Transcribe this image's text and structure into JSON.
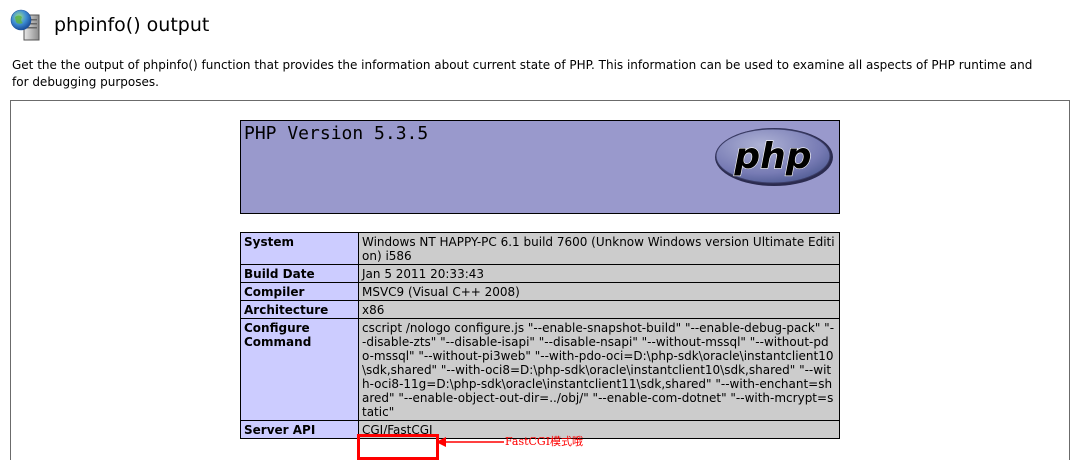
{
  "header": {
    "title": "phpinfo() output",
    "description": "Get the the output of phpinfo() function that provides the information about current state of PHP. This information can be used to examine all aspects of PHP runtime and for debugging purposes."
  },
  "php": {
    "version_title": "PHP Version 5.3.5",
    "logo_text": "php"
  },
  "info_rows": [
    {
      "label": "System",
      "value": "Windows NT HAPPY-PC 6.1 build 7600 (Unknow Windows version Ultimate Edition) i586"
    },
    {
      "label": "Build Date",
      "value": "Jan 5 2011 20:33:43"
    },
    {
      "label": "Compiler",
      "value": "MSVC9 (Visual C++ 2008)"
    },
    {
      "label": "Architecture",
      "value": "x86"
    },
    {
      "label": "Configure Command",
      "value": "cscript /nologo configure.js \"--enable-snapshot-build\" \"--enable-debug-pack\" \"--disable-zts\" \"--disable-isapi\" \"--disable-nsapi\" \"--without-mssql\" \"--without-pdo-mssql\" \"--without-pi3web\" \"--with-pdo-oci=D:\\php-sdk\\oracle\\instantclient10\\sdk,shared\" \"--with-oci8=D:\\php-sdk\\oracle\\instantclient10\\sdk,shared\" \"--with-oci8-11g=D:\\php-sdk\\oracle\\instantclient11\\sdk,shared\" \"--with-enchant=shared\" \"--enable-object-out-dir=../obj/\" \"--enable-com-dotnet\" \"--with-mcrypt=static\""
    },
    {
      "label": "Server API",
      "value": "CGI/FastCGI"
    }
  ],
  "annotation": {
    "text": "FastCGI模式哦",
    "color": "#ff0000"
  },
  "colors": {
    "header_bg": "#9999cc",
    "label_bg": "#ccccff",
    "value_bg": "#cccccc",
    "accent": "#ff0000"
  }
}
